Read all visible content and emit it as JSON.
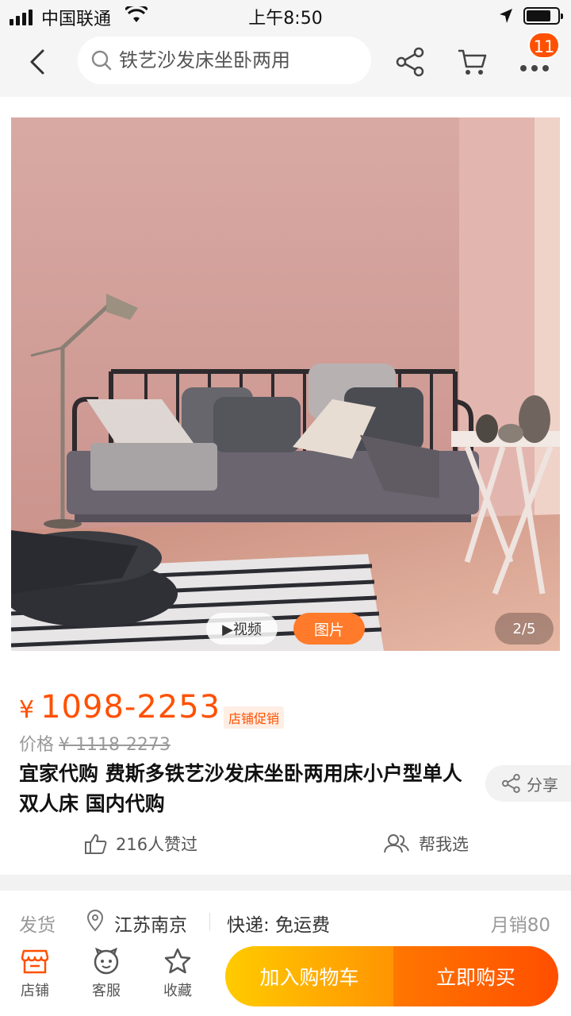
{
  "status_bar": {
    "carrier": "中国联通",
    "time": "上午8:50"
  },
  "nav": {
    "search_placeholder": "铁艺沙发床坐卧两用",
    "badge_count": "11",
    "icons": [
      "back-arrow-icon",
      "search-icon",
      "share-icon",
      "cart-icon",
      "more-icon"
    ]
  },
  "gallery": {
    "video_label": "▶视频",
    "image_label": "图片",
    "pager": "2/5"
  },
  "product": {
    "currency": "¥",
    "price": "1098-2253",
    "promo_tag": "店铺促销",
    "orig_label": "价格",
    "orig_price": "¥ 1118-2273",
    "title": "宜家代购 费斯多铁艺沙发床坐卧两用床小户型单人双人床 国内代购",
    "share_label": "分享",
    "likes": "216人赞过",
    "help_choose": "帮我选"
  },
  "shipping": {
    "label": "发货",
    "location": "江苏南京",
    "express": "快递: 免运费",
    "monthly_sales": "月销80"
  },
  "bottom_bar": {
    "store": "店铺",
    "service": "客服",
    "favorite": "收藏",
    "add_to_cart": "加入购物车",
    "buy_now": "立即购买"
  },
  "colors": {
    "accent": "#ff5000",
    "cart_button": "#ffb000",
    "buy_button": "#ff6000"
  }
}
